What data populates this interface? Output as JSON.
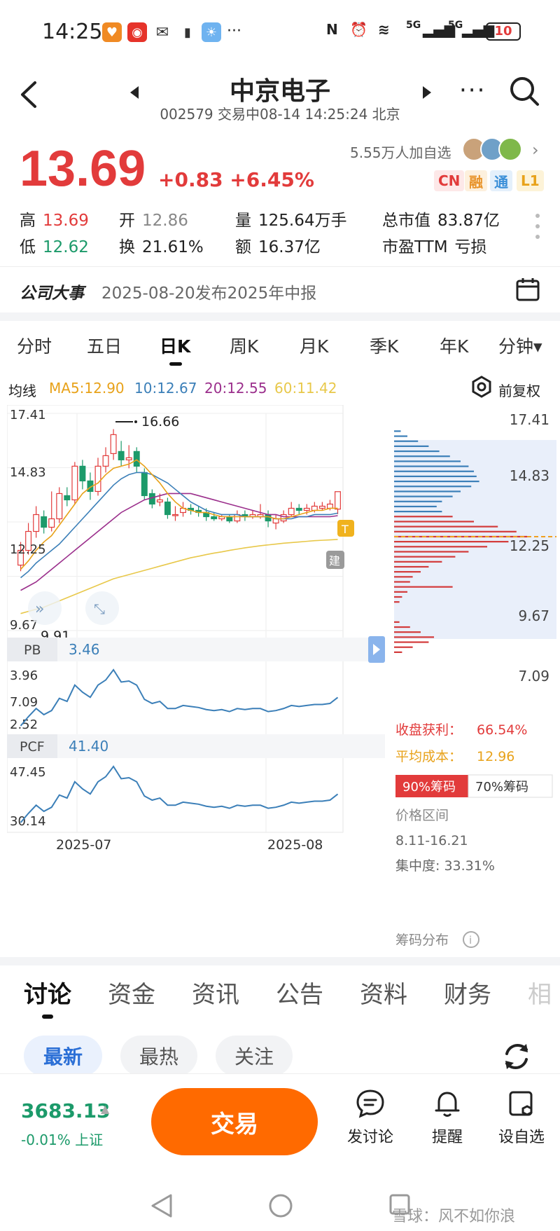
{
  "status_bar": {
    "time": "14:25",
    "battery": "10",
    "net1": "5G",
    "net2": "5G"
  },
  "header": {
    "title": "中京电子",
    "subtitle": "002579 交易中08-14 14:25:24 北京"
  },
  "quote": {
    "price": "13.69",
    "change": "+0.83 +6.45%",
    "followers": "5.55万人加自选",
    "tags": [
      "CN",
      "融",
      "通",
      "L1"
    ],
    "stats": {
      "high_label": "高",
      "high": "13.69",
      "low_label": "低",
      "low": "12.62",
      "open_label": "开",
      "open": "12.86",
      "turnover_label": "换",
      "turnover": "21.61%",
      "volume_label": "量",
      "volume": "125.64万手",
      "amount_label": "额",
      "amount": "16.37亿",
      "mktcap_label": "总市值",
      "mktcap": "83.87亿",
      "pe_label": "市盈TTM",
      "pe": "亏损"
    }
  },
  "event": {
    "label": "公司大事",
    "text": "2025-08-20发布2025年中报"
  },
  "period_tabs": [
    "分时",
    "五日",
    "日K",
    "周K",
    "月K",
    "季K",
    "年K",
    "分钟▾"
  ],
  "ma_line": {
    "label": "均线",
    "ma5": "MA5:12.90",
    "ma10": "10:12.67",
    "ma20": "20:12.55",
    "ma60": "60:11.42",
    "adjust": "前复权"
  },
  "colors": {
    "up": "#e23b3b",
    "down": "#1c9a6a",
    "ma5": "#e8a21a",
    "ma10": "#3b7fb8",
    "ma20": "#9b2f8c",
    "ma60": "#e8c84a",
    "accent": "#ff6a00"
  },
  "kline": {
    "y_ticks": [
      "17.41",
      "14.83",
      "12.25",
      "9.67",
      "7.09"
    ],
    "high_mark": "16.66",
    "low_mark": "9.91",
    "badge_t": "T",
    "badge_jian": "建",
    "x_labels": [
      "2025-07",
      "2025-08"
    ],
    "y_range": [
      7.09,
      17.41
    ],
    "candles": [
      {
        "o": 10.2,
        "c": 10.9,
        "h": 11.3,
        "l": 9.91
      },
      {
        "o": 10.9,
        "c": 11.8,
        "h": 12.2,
        "l": 10.7
      },
      {
        "o": 11.8,
        "c": 12.6,
        "h": 13.0,
        "l": 11.5
      },
      {
        "o": 12.5,
        "c": 12.0,
        "h": 12.8,
        "l": 11.7
      },
      {
        "o": 12.0,
        "c": 12.4,
        "h": 13.7,
        "l": 11.8
      },
      {
        "o": 12.4,
        "c": 13.6,
        "h": 13.9,
        "l": 12.2
      },
      {
        "o": 13.5,
        "c": 13.3,
        "h": 13.9,
        "l": 13.0
      },
      {
        "o": 13.3,
        "c": 14.9,
        "h": 15.1,
        "l": 13.1
      },
      {
        "o": 14.9,
        "c": 14.2,
        "h": 15.2,
        "l": 13.8
      },
      {
        "o": 14.2,
        "c": 13.7,
        "h": 14.6,
        "l": 13.3
      },
      {
        "o": 13.7,
        "c": 14.9,
        "h": 15.3,
        "l": 13.5
      },
      {
        "o": 14.9,
        "c": 15.4,
        "h": 15.8,
        "l": 14.6
      },
      {
        "o": 15.5,
        "c": 16.4,
        "h": 16.66,
        "l": 15.2
      },
      {
        "o": 15.6,
        "c": 15.2,
        "h": 16.1,
        "l": 14.9
      },
      {
        "o": 15.2,
        "c": 15.3,
        "h": 15.9,
        "l": 14.8
      },
      {
        "o": 15.6,
        "c": 14.9,
        "h": 15.8,
        "l": 14.6
      },
      {
        "o": 14.6,
        "c": 13.5,
        "h": 14.8,
        "l": 13.3
      },
      {
        "o": 13.6,
        "c": 13.1,
        "h": 13.8,
        "l": 12.9
      },
      {
        "o": 13.2,
        "c": 13.3,
        "h": 13.6,
        "l": 13.0
      },
      {
        "o": 13.2,
        "c": 12.6,
        "h": 13.4,
        "l": 12.4
      },
      {
        "o": 12.6,
        "c": 12.6,
        "h": 13.0,
        "l": 12.3
      },
      {
        "o": 12.7,
        "c": 12.9,
        "h": 13.2,
        "l": 12.5
      },
      {
        "o": 12.9,
        "c": 12.8,
        "h": 13.1,
        "l": 12.6
      },
      {
        "o": 12.8,
        "c": 12.7,
        "h": 13.0,
        "l": 12.5
      },
      {
        "o": 12.7,
        "c": 12.5,
        "h": 12.9,
        "l": 12.3
      },
      {
        "o": 12.5,
        "c": 12.4,
        "h": 12.7,
        "l": 12.3
      },
      {
        "o": 12.4,
        "c": 12.5,
        "h": 12.6,
        "l": 12.3
      },
      {
        "o": 12.5,
        "c": 12.3,
        "h": 12.6,
        "l": 12.2
      },
      {
        "o": 12.3,
        "c": 12.6,
        "h": 12.8,
        "l": 12.2
      },
      {
        "o": 12.6,
        "c": 12.5,
        "h": 12.8,
        "l": 12.3
      },
      {
        "o": 12.5,
        "c": 12.6,
        "h": 12.8,
        "l": 12.4
      },
      {
        "o": 12.5,
        "c": 12.6,
        "h": 13.1,
        "l": 12.4
      },
      {
        "o": 12.6,
        "c": 12.3,
        "h": 12.8,
        "l": 12.0
      },
      {
        "o": 12.2,
        "c": 12.4,
        "h": 12.6,
        "l": 11.9
      },
      {
        "o": 12.3,
        "c": 12.6,
        "h": 12.8,
        "l": 12.2
      },
      {
        "o": 12.6,
        "c": 12.9,
        "h": 13.2,
        "l": 12.5
      },
      {
        "o": 12.9,
        "c": 12.8,
        "h": 13.1,
        "l": 12.6
      },
      {
        "o": 12.8,
        "c": 12.9,
        "h": 13.1,
        "l": 12.6
      },
      {
        "o": 12.8,
        "c": 13.0,
        "h": 13.2,
        "l": 12.7
      },
      {
        "o": 12.9,
        "c": 13.0,
        "h": 13.2,
        "l": 12.8
      },
      {
        "o": 12.9,
        "c": 13.1,
        "h": 13.3,
        "l": 12.8
      },
      {
        "o": 12.86,
        "c": 13.69,
        "h": 13.69,
        "l": 12.62
      }
    ],
    "ma5": [
      10.0,
      10.4,
      10.9,
      11.3,
      11.6,
      12.1,
      12.6,
      13.1,
      13.6,
      13.9,
      14.1,
      14.5,
      14.8,
      14.9,
      15.0,
      15.2,
      14.9,
      14.5,
      14.1,
      13.6,
      13.2,
      12.9,
      12.8,
      12.7,
      12.7,
      12.6,
      12.5,
      12.5,
      12.5,
      12.5,
      12.5,
      12.5,
      12.5,
      12.4,
      12.4,
      12.5,
      12.6,
      12.7,
      12.8,
      12.8,
      12.9,
      12.9
    ],
    "ma10": [
      9.6,
      9.9,
      10.3,
      10.6,
      10.9,
      11.2,
      11.6,
      12.0,
      12.4,
      12.8,
      13.2,
      13.6,
      14.0,
      14.3,
      14.5,
      14.6,
      14.6,
      14.5,
      14.3,
      14.1,
      13.8,
      13.5,
      13.2,
      13.0,
      12.8,
      12.7,
      12.6,
      12.6,
      12.6,
      12.5,
      12.5,
      12.5,
      12.5,
      12.4,
      12.4,
      12.4,
      12.5,
      12.5,
      12.6,
      12.6,
      12.6,
      12.67
    ],
    "ma20": [
      9.0,
      9.2,
      9.4,
      9.7,
      10.0,
      10.3,
      10.6,
      10.9,
      11.2,
      11.5,
      11.8,
      12.1,
      12.4,
      12.7,
      12.9,
      13.1,
      13.3,
      13.4,
      13.5,
      13.6,
      13.6,
      13.6,
      13.6,
      13.5,
      13.4,
      13.3,
      13.2,
      13.1,
      13.0,
      12.9,
      12.8,
      12.7,
      12.6,
      12.6,
      12.5,
      12.5,
      12.5,
      12.5,
      12.5,
      12.5,
      12.5,
      12.55
    ],
    "ma60": [
      7.9,
      8.0,
      8.1,
      8.2,
      8.35,
      8.5,
      8.65,
      8.8,
      8.95,
      9.1,
      9.25,
      9.4,
      9.55,
      9.65,
      9.75,
      9.85,
      9.95,
      10.05,
      10.15,
      10.25,
      10.35,
      10.45,
      10.55,
      10.62,
      10.7,
      10.77,
      10.83,
      10.9,
      10.96,
      11.02,
      11.07,
      11.12,
      11.16,
      11.2,
      11.24,
      11.27,
      11.3,
      11.33,
      11.36,
      11.38,
      11.4,
      11.42
    ]
  },
  "pb": {
    "label": "PB",
    "value": "3.46",
    "y_top": "3.96",
    "y_bottom": "2.52"
  },
  "pcf": {
    "label": "PCF",
    "value": "41.40",
    "y_top": "47.45",
    "y_bottom": "30.14"
  },
  "chip": {
    "y_ticks": [
      "17.41",
      "14.83",
      "12.25",
      "9.67",
      "7.09"
    ],
    "profit_label": "收盘获利：",
    "profit": "66.54%",
    "avg_label": "平均成本：",
    "avg": "12.96",
    "tab90": "90%筹码",
    "tab70": "70%筹码",
    "range_label": "价格区间",
    "range": "8.11-16.21",
    "concentration": "集中度: 33.31%",
    "dist_label": "筹码分布"
  },
  "content_tabs": [
    "讨论",
    "资金",
    "资讯",
    "公告",
    "资料",
    "财务",
    "相"
  ],
  "filter_pills": [
    "最新",
    "最热",
    "关注"
  ],
  "bottom_bar": {
    "index_value": "3683.13",
    "index_sub": "-0.01% 上证",
    "trade": "交易",
    "discuss": "发讨论",
    "remind": "提醒",
    "watch": "设自选"
  },
  "watermark": "雪球：风不如你浪"
}
